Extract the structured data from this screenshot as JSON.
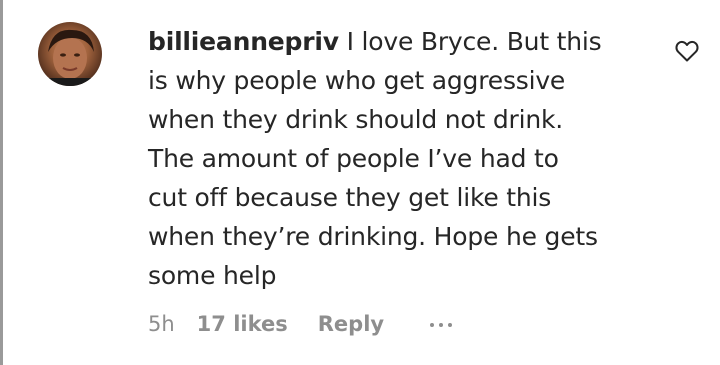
{
  "comment": {
    "username": "billieannepriv",
    "text": " I love Bryce. But this\nis why people who get aggressive\nwhen they drink should not drink.\nThe amount of people I’ve had to\ncut off because they get like this\nwhen they’re drinking. Hope he gets\nsome help",
    "time": "5h",
    "likes": "17 likes",
    "reply_label": "Reply",
    "avatar_icon": "user-avatar",
    "like_icon": "heart-outline-icon",
    "more_icon": "more-options-icon"
  }
}
